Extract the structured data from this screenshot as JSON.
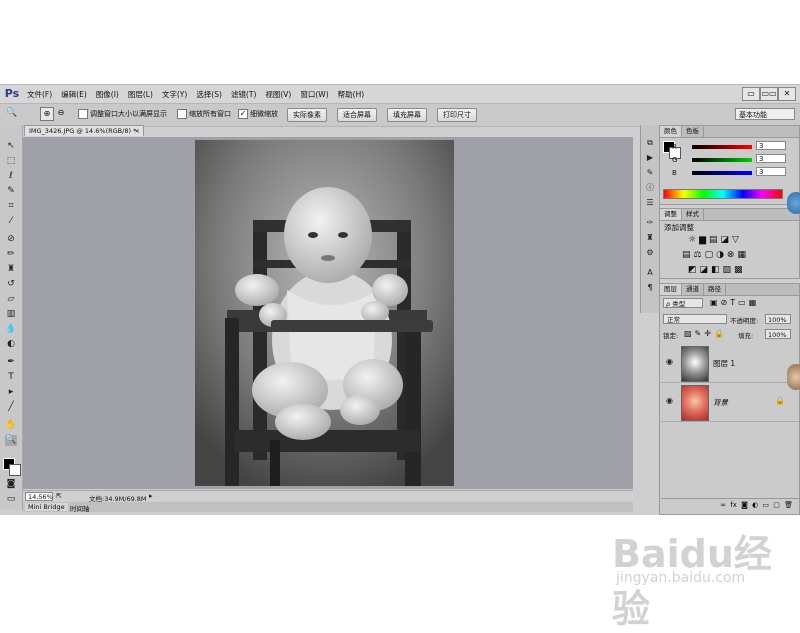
{
  "app": {
    "logo_text": "Ps",
    "menu": [
      "文件(F)",
      "编辑(E)",
      "图像(I)",
      "图层(L)",
      "文字(Y)",
      "选择(S)",
      "滤镜(T)",
      "视图(V)",
      "窗口(W)",
      "帮助(H)"
    ],
    "window_controls": [
      "▭",
      "▭▭",
      "✕"
    ]
  },
  "options": {
    "checkbox1_label": "调整窗口大小以满屏显示",
    "checkbox2_label": "缩放所有窗口",
    "checkbox3_label": "细微缩放",
    "checkbox3_checked": "✓",
    "btn_actual": "实际像素",
    "btn_fit": "适合屏幕",
    "btn_fill": "填充屏幕",
    "btn_print": "打印尺寸",
    "workspace": "基本功能"
  },
  "document": {
    "tab_title": "IMG_3426.JPG @ 14.6%(RGB/8) *",
    "tab_close": "×",
    "zoom": "14.56%",
    "doc_info": "文档:34.9M/69.8M",
    "bottom_tab1": "Mini Bridge",
    "bottom_tab2": "时间轴"
  },
  "color_panel": {
    "tab1": "颜色",
    "tab2": "色板",
    "r_label": "R",
    "g_label": "G",
    "b_label": "B",
    "r_value": "3",
    "g_value": "3",
    "b_value": "3"
  },
  "adjust_panel": {
    "tab1": "调整",
    "tab2": "样式",
    "title": "添加调整"
  },
  "layers_panel": {
    "tab1": "图层",
    "tab2": "通道",
    "tab3": "路径",
    "filter": "ρ 类型",
    "blend_mode": "正常",
    "opacity_label": "不透明度:",
    "opacity_value": "100%",
    "lock_label": "锁定:",
    "fill_label": "填充:",
    "fill_value": "100%",
    "layers": [
      {
        "name": "图层 1"
      },
      {
        "name": "背景"
      }
    ],
    "footer_icons": "∞ fx ◙ ◐ ▭ ▢ 🗑"
  },
  "watermark": {
    "brand": "Baidu经验",
    "url": "jingyan.baidu.com"
  },
  "colors": {
    "app_bg": "#cfcfcf",
    "canvas_bg": "#a0a0a8",
    "ps_blue": "#2b3a8c"
  }
}
